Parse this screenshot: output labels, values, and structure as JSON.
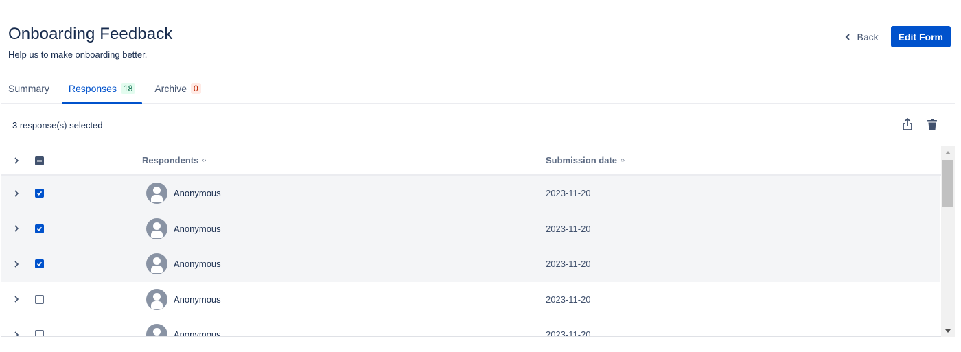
{
  "header": {
    "title": "Onboarding Feedback",
    "subtitle": "Help us to make onboarding better.",
    "back_label": "Back",
    "edit_label": "Edit Form"
  },
  "tabs": [
    {
      "label": "Summary",
      "badge": null,
      "active": false
    },
    {
      "label": "Responses",
      "badge": "18",
      "badge_color": "green",
      "active": true
    },
    {
      "label": "Archive",
      "badge": "0",
      "badge_color": "red",
      "active": false
    }
  ],
  "selection": {
    "text": "3 response(s) selected",
    "icons": [
      "share-icon",
      "trash-icon"
    ]
  },
  "table": {
    "columns": [
      "Respondents",
      "Submission date"
    ],
    "rows": [
      {
        "respondent": "Anonymous",
        "date": "2023-11-20",
        "selected": true
      },
      {
        "respondent": "Anonymous",
        "date": "2023-11-20",
        "selected": true
      },
      {
        "respondent": "Anonymous",
        "date": "2023-11-20",
        "selected": true
      },
      {
        "respondent": "Anonymous",
        "date": "2023-11-20",
        "selected": false
      },
      {
        "respondent": "Anonymous",
        "date": "2023-11-20",
        "selected": false
      }
    ]
  },
  "colors": {
    "accent": "#0052cc",
    "text": "#172b4d",
    "muted": "#5e6c84",
    "selected_row": "#f4f5f7"
  }
}
